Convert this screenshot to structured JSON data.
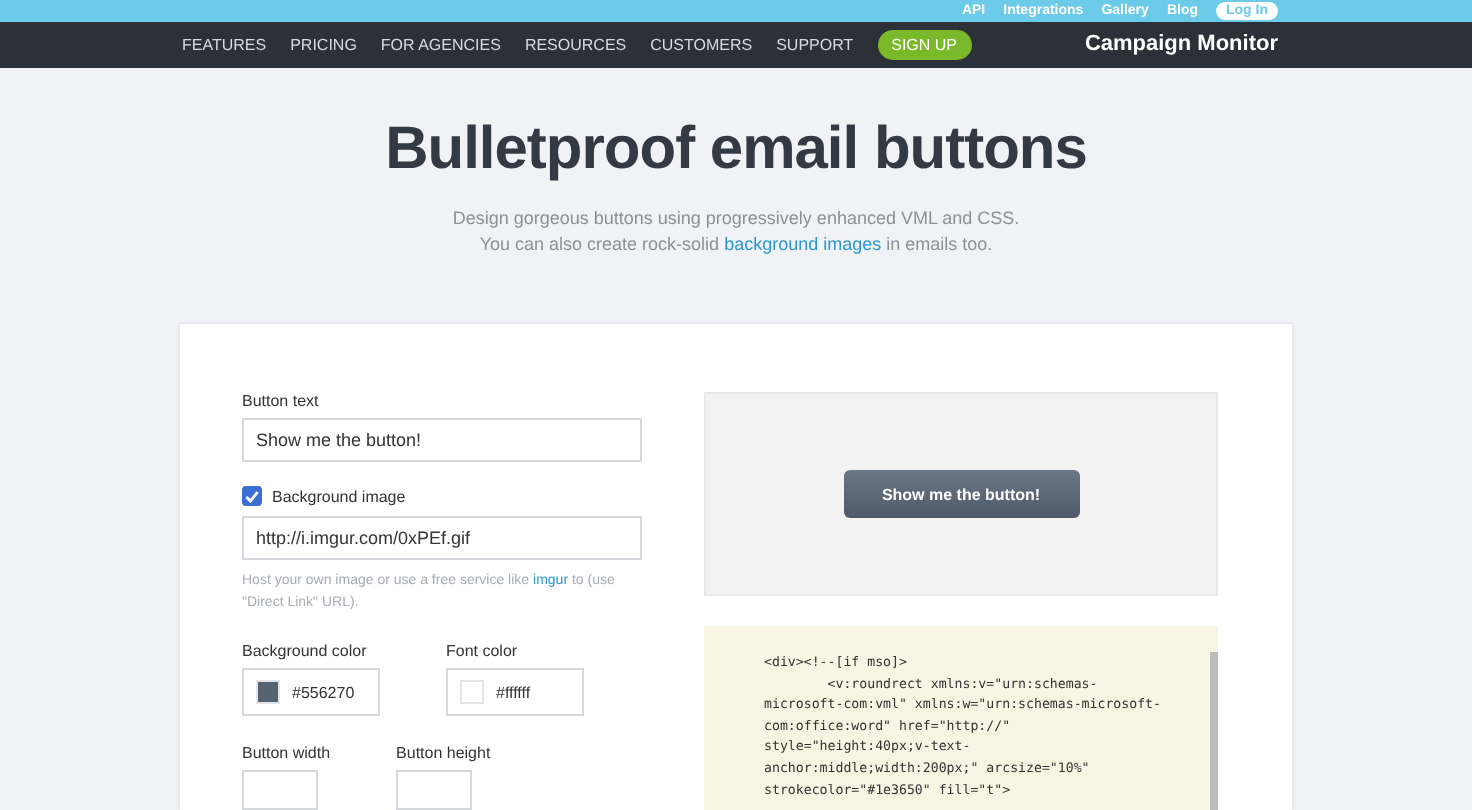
{
  "top_links": [
    {
      "label": "API",
      "kind": "link"
    },
    {
      "label": "Integrations",
      "kind": "link"
    },
    {
      "label": "Gallery",
      "kind": "link"
    },
    {
      "label": "Blog",
      "kind": "link"
    },
    {
      "label": "Log In",
      "kind": "pill"
    }
  ],
  "nav": {
    "items": [
      {
        "label": "FEATURES",
        "kind": "link"
      },
      {
        "label": "PRICING",
        "kind": "link"
      },
      {
        "label": "FOR AGENCIES",
        "kind": "link"
      },
      {
        "label": "RESOURCES",
        "kind": "link"
      },
      {
        "label": "CUSTOMERS",
        "kind": "link"
      },
      {
        "label": "SUPPORT",
        "kind": "link"
      },
      {
        "label": "SIGN UP",
        "kind": "pill"
      }
    ],
    "brand": "Campaign Monitor"
  },
  "hero": {
    "title": "Bulletproof email buttons",
    "intro_before": "Design gorgeous buttons using progressively enhanced VML and CSS. You can also create rock-solid",
    "intro_link": "background images",
    "intro_after": "in emails too."
  },
  "form": {
    "button_text": {
      "label": "Button text",
      "value": "Show me the button!"
    },
    "background_image": {
      "label": "Background image",
      "checked": true,
      "value": "http://i.imgur.com/0xPEf.gif",
      "hint_before": "Host your own image or use a free service like",
      "hint_link": "imgur",
      "hint_after": "to (use \"Direct Link\" URL)."
    },
    "colors": [
      {
        "label": "Background color",
        "color": "#556270",
        "value": "#556270"
      },
      {
        "label": "Font color",
        "color": "#ffffff",
        "value": "#ffffff"
      }
    ],
    "sizes": [
      {
        "label": "Button width"
      },
      {
        "label": "Button height"
      }
    ]
  },
  "preview": {
    "button": "Show me the button!"
  },
  "code": [
    "<div><!--[if mso]>",
    "        <v:roundrect xmlns:v=\"urn:schemas-",
    "microsoft-com:vml\" xmlns:w=\"urn:schemas-microsoft-",
    "com:office:word\" href=\"http://\"",
    "style=\"height:40px;v-text-",
    "anchor:middle;width:200px;\" arcsize=\"10%\"",
    "strokecolor=\"#1e3650\" fill=\"t\">"
  ]
}
